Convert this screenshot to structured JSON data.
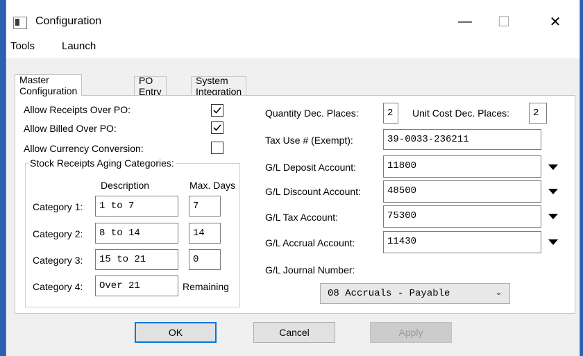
{
  "window": {
    "title": "Configuration",
    "controls": {
      "minimize": "—",
      "maximize": "☐",
      "close": "✕"
    }
  },
  "menu": [
    "Tools",
    "Launch"
  ],
  "tabs": [
    "Master Configuration",
    "PO Entry",
    "System Integration"
  ],
  "left": {
    "allow_receipts_over_po": {
      "label": "Allow Receipts Over PO:",
      "checked": true
    },
    "allow_billed_over_po": {
      "label": "Allow Billed Over PO:",
      "checked": true
    },
    "allow_currency_conversion": {
      "label": "Allow Currency Conversion:",
      "checked": false
    },
    "aging": {
      "title": "Stock Receipts Aging Categories:",
      "col_description": "Description",
      "col_max_days": "Max. Days",
      "categories": [
        {
          "label": "Category 1:",
          "description": "1 to 7",
          "max_days": "7"
        },
        {
          "label": "Category 2:",
          "description": "8 to 14",
          "max_days": "14"
        },
        {
          "label": "Category 3:",
          "description": "15 to 21",
          "max_days": "0"
        },
        {
          "label": "Category 4:",
          "description": "Over 21",
          "max_days": "Remaining"
        }
      ]
    }
  },
  "right": {
    "quantity_dec_places": {
      "label": "Quantity Dec. Places:",
      "value": "2"
    },
    "unit_cost_dec_places": {
      "label": "Unit Cost Dec. Places:",
      "value": "2"
    },
    "tax_use_number": {
      "label": "Tax Use # (Exempt):",
      "value": "39-0033-236211"
    },
    "gl_deposit_account": {
      "label": "G/L Deposit Account:",
      "value": "11800"
    },
    "gl_discount_account": {
      "label": "G/L Discount Account:",
      "value": "48500"
    },
    "gl_tax_account": {
      "label": "G/L Tax Account:",
      "value": "75300"
    },
    "gl_accrual_account": {
      "label": "G/L Accrual Account:",
      "value": "11430"
    },
    "gl_journal_number": {
      "label": "G/L Journal Number:",
      "value": "08 Accruals - Payable"
    }
  },
  "buttons": {
    "ok": "OK",
    "cancel": "Cancel",
    "apply": "Apply"
  },
  "colors": {
    "accent": "#0078d7",
    "frame": "#2b5fb0"
  }
}
